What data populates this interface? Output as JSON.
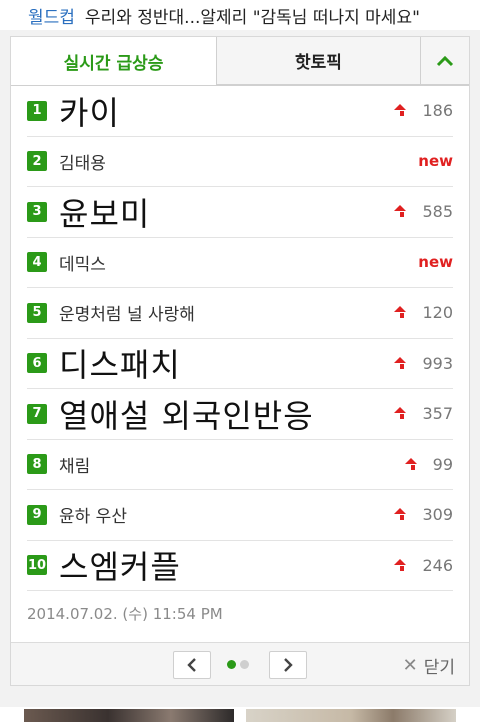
{
  "headline": {
    "category": "월드컵",
    "title": "우리와 정반대...알제리 \"감독님 떠나지 마세요\""
  },
  "tabs": {
    "active": "실시간 급상승",
    "inactive": "핫토픽",
    "toggle_icon": "chevron-up-icon"
  },
  "ranking": [
    {
      "rank": "1",
      "keyword": "카이",
      "change": "186",
      "is_new": false,
      "big": true
    },
    {
      "rank": "2",
      "keyword": "김태용",
      "change": "new",
      "is_new": true,
      "big": false
    },
    {
      "rank": "3",
      "keyword": "윤보미",
      "change": "585",
      "is_new": false,
      "big": true
    },
    {
      "rank": "4",
      "keyword": "데믹스",
      "change": "new",
      "is_new": true,
      "big": false
    },
    {
      "rank": "5",
      "keyword": "운명처럼 널 사랑해",
      "change": "120",
      "is_new": false,
      "big": false
    },
    {
      "rank": "6",
      "keyword": "디스패치",
      "change": "993",
      "is_new": false,
      "big": true
    },
    {
      "rank": "7",
      "keyword": "열애설  외국인반응",
      "change": "357",
      "is_new": false,
      "big": true
    },
    {
      "rank": "8",
      "keyword": "채림",
      "change": "99",
      "is_new": false,
      "big": false
    },
    {
      "rank": "9",
      "keyword": "윤하 우산",
      "change": "309",
      "is_new": false,
      "big": false
    },
    {
      "rank": "10",
      "keyword": "스엠커플",
      "change": "246",
      "is_new": false,
      "big": true
    }
  ],
  "timestamp": "2014.07.02. (수) 11:54 PM",
  "footer": {
    "prev_icon": "chevron-left-icon",
    "next_icon": "chevron-right-icon",
    "close_label": "닫기",
    "page_current": 1,
    "page_total": 2
  },
  "colors": {
    "accent": "#2b9a18",
    "up": "#e02020",
    "link": "#2a6fbf"
  }
}
